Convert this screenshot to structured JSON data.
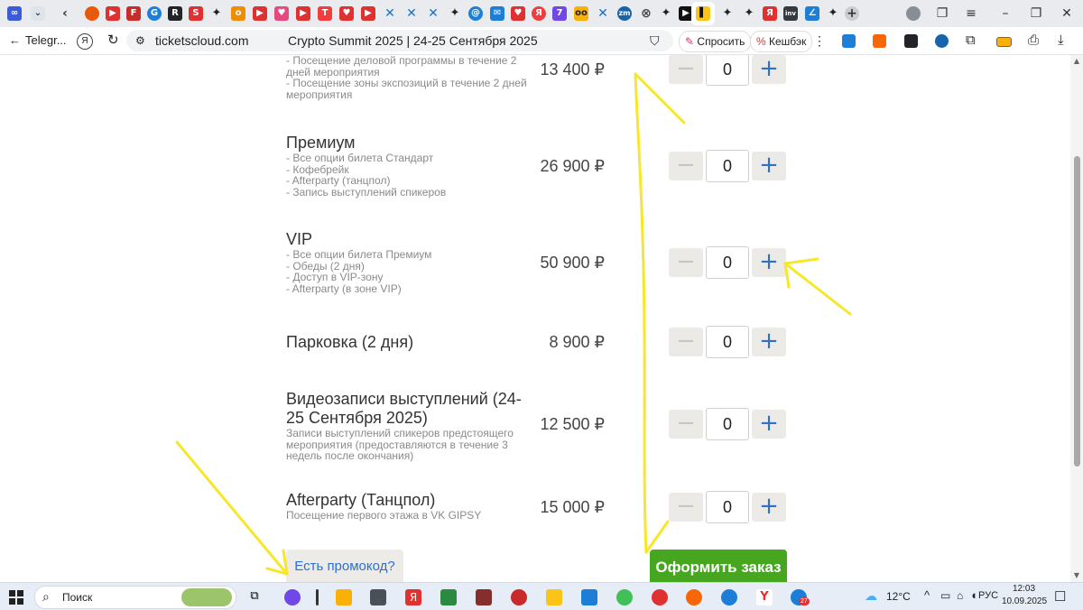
{
  "browser": {
    "back_label": "Telegr...",
    "ya_label": "Я",
    "url": "ticketscloud.com",
    "page_title": "Crypto Summit 2025 | 24-25 Сентября 2025",
    "ask_label": "Спросить",
    "cashback_label": "Кешбэк",
    "tab_icon_labels": {
      "g": "G",
      "r": "R",
      "s": "S",
      "t": "T",
      "zm": "zm",
      "inv": "inv",
      "at": "@",
      "seven": "7",
      "ya": "Я"
    }
  },
  "tickets": [
    {
      "name": "",
      "lines": [
        "- Посещение деловой программы в течение 2",
        "дней мероприятия",
        "- Посещение зоны экспозиций в течение 2 дней",
        "мероприятия"
      ],
      "price": "13 400 ₽",
      "qty": "0"
    },
    {
      "name": "Премиум",
      "lines": [
        "- Все опции билета Стандарт",
        "- Кофебрейк",
        "- Afterparty (танцпол)",
        "- Запись выступлений спикеров"
      ],
      "price": "26 900 ₽",
      "qty": "0"
    },
    {
      "name": "VIP",
      "lines": [
        "- Все опции билета Премиум",
        "- Обеды (2 дня)",
        "- Доступ в VIP-зону",
        "- Afterparty (в зоне VIP)"
      ],
      "price": "50 900 ₽",
      "qty": "0"
    },
    {
      "name": "Парковка (2 дня)",
      "lines": [],
      "price": "8 900 ₽",
      "qty": "0"
    },
    {
      "name_lines": [
        "Видеозаписи выступлений (24-",
        "25 Сентября 2025)"
      ],
      "lines": [
        "Записи выступлений спикеров предстоящего",
        "мероприятия (предоставляются в течение 3",
        "недель после окончания)"
      ],
      "price": "12 500 ₽",
      "qty": "0"
    },
    {
      "name": "Afterparty (Танцпол)",
      "lines": [
        "Посещение первого этажа в VK GIPSY"
      ],
      "price": "15 000 ₽",
      "qty": "0"
    }
  ],
  "controls": {
    "minus_symbol": "−",
    "plus_symbol": "+",
    "promo_label": "Есть промокод?",
    "order_label": "Оформить заказ"
  },
  "taskbar": {
    "search_label": "Поиск",
    "weather": "12°C",
    "lang": "РУС",
    "time": "12:03",
    "date": "10.09.2025",
    "badge_telegram": "27",
    "ya_label": "Я",
    "y_label": "Y"
  },
  "colors": {
    "accent_blue": "#2f6fce",
    "order_green": "#46a620",
    "annotation_yellow": "#f7e62a"
  }
}
